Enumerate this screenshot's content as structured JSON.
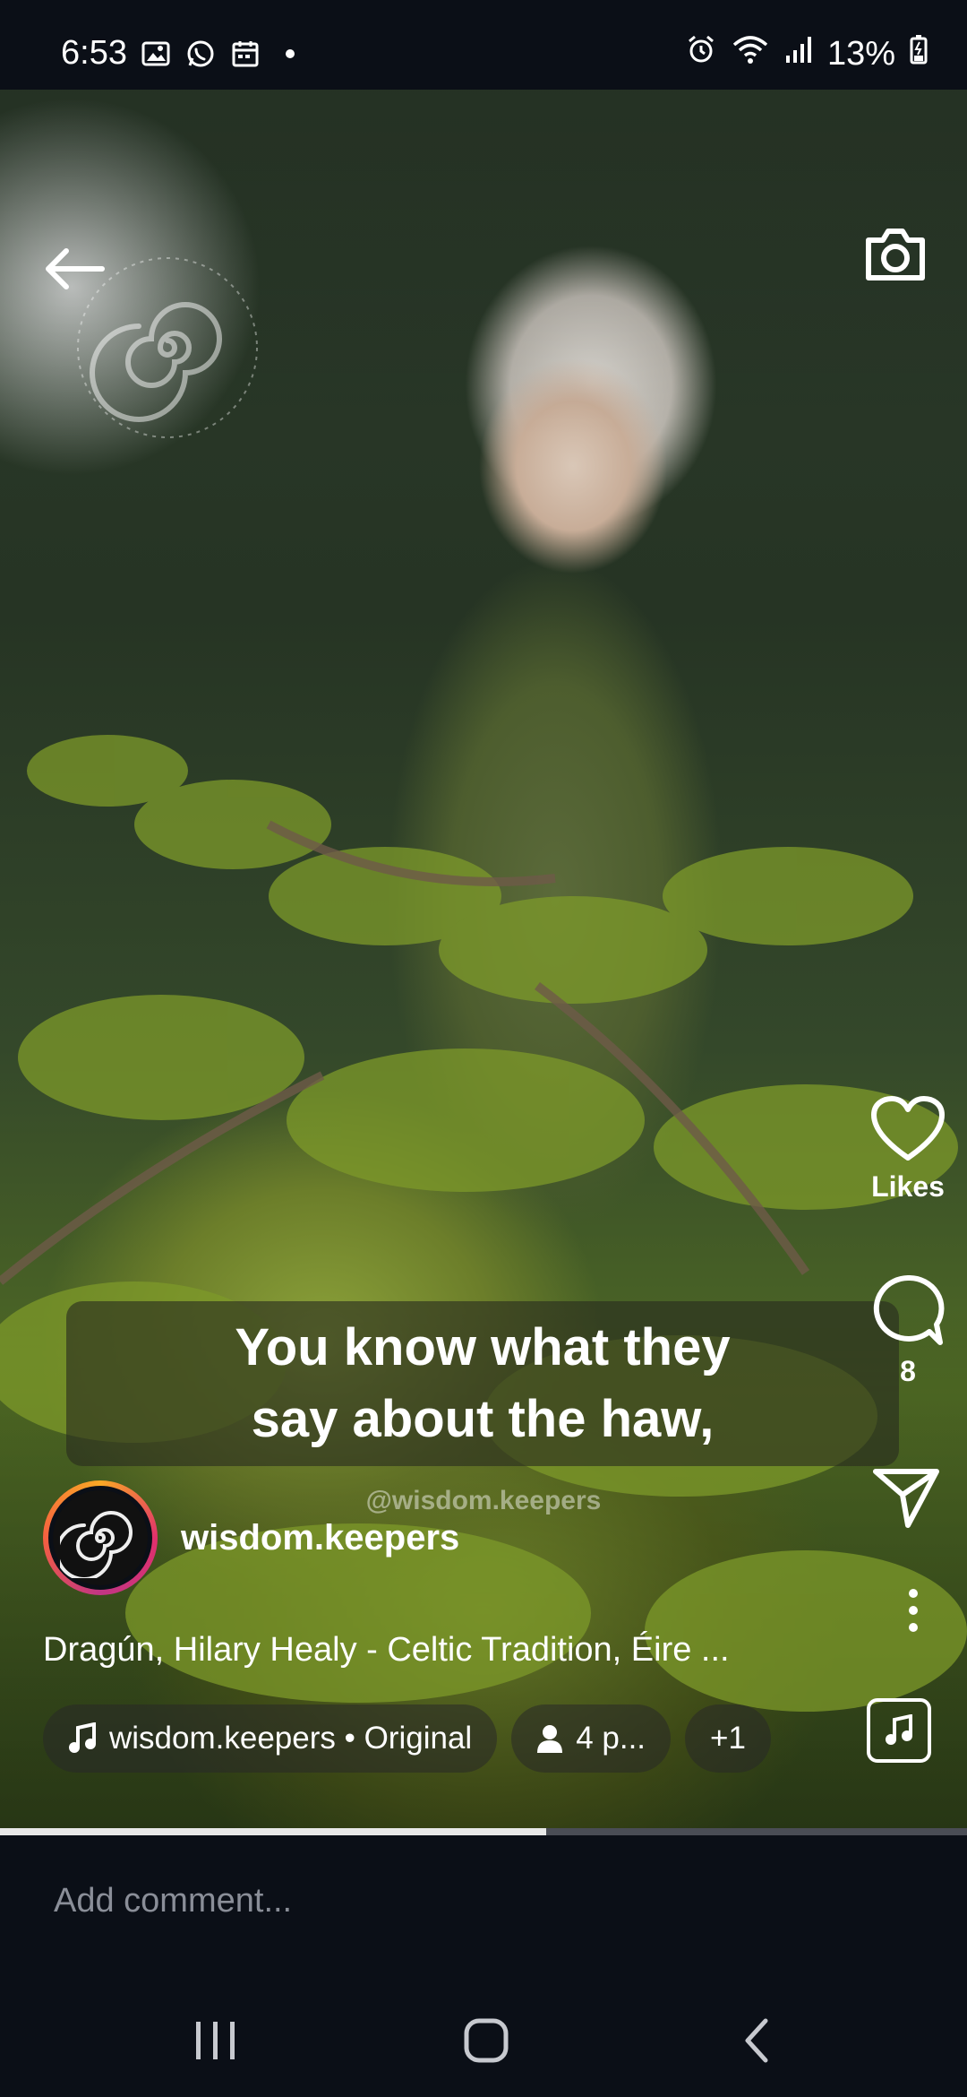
{
  "status_bar": {
    "time": "6:53",
    "battery": "13%",
    "left_icons": [
      "gallery-icon",
      "whatsapp-icon",
      "calendar-icon",
      "dot-icon"
    ],
    "right_icons": [
      "alarm-icon",
      "wifi-icon",
      "signal-icon",
      "battery-icon"
    ]
  },
  "video": {
    "caption_line1": "You know what they",
    "caption_line2": "say about the haw,",
    "watermark_handle": "@wisdom.keepers"
  },
  "rail": {
    "likes_label": "Likes",
    "comments_count": "8"
  },
  "post": {
    "author": "wisdom.keepers",
    "description": "Dragún, Hilary Healy - Celtic Tradition, Éire ...",
    "audio_chip": "wisdom.keepers • Original",
    "people_chip": "4 p...",
    "more_chip": "+1"
  },
  "progress": {
    "fraction": 0.565
  },
  "comment": {
    "placeholder": "Add comment..."
  },
  "colors": {
    "background": "#0b0f17",
    "avatar_ring": "#e1306c",
    "placeholder_text": "#8a8e98"
  }
}
